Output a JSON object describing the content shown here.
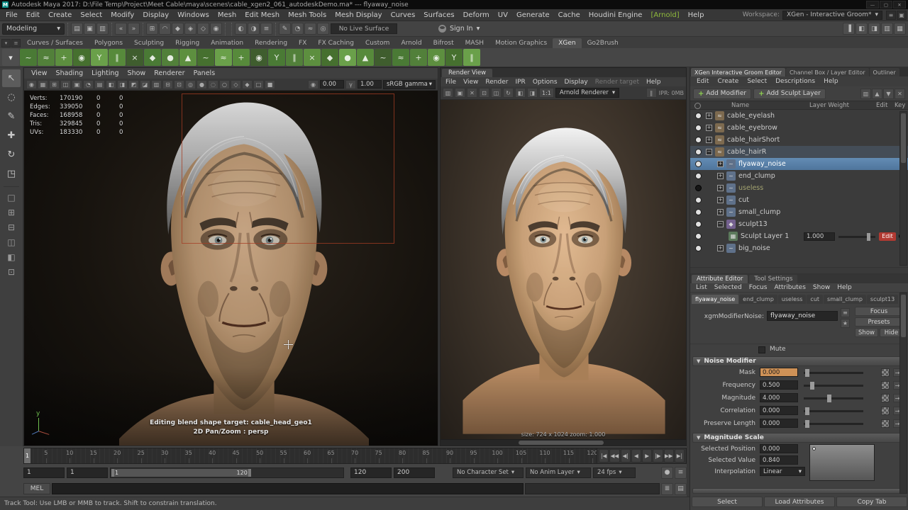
{
  "window": {
    "title": "Autodesk Maya 2017: D:\\File Temp\\Project\\Meet Cable\\maya\\scenes\\cable_xgen2_061_autodeskDemo.ma* --- flyaway_noise",
    "controls": {
      "minimize": "—",
      "maximize": "▢",
      "close": "✕"
    }
  },
  "menu_bar": {
    "items": [
      "File",
      "Edit",
      "Create",
      "Select",
      "Modify",
      "Display",
      "Windows",
      "Mesh",
      "Edit Mesh",
      "Mesh Tools",
      "Mesh Display",
      "Curves",
      "Surfaces",
      "Deform",
      "UV",
      "Generate",
      "Cache",
      "Houdini Engine",
      "[Arnold]",
      "Help"
    ],
    "workspace_label": "Workspace:",
    "workspace_value": "XGen - Interactive Groom*"
  },
  "status_line": {
    "menu_set": "Modeling",
    "live_surface": "No Live Surface",
    "sign_in": "Sign In",
    "icon_groups": [
      [
        "new-scene-icon",
        "open-scene-icon",
        "save-scene-icon"
      ],
      [
        "undo-icon",
        "redo-icon"
      ],
      [
        "snap-to-grid-icon",
        "snap-to-curve-icon",
        "snap-to-point-icon",
        "snap-to-projected-center-icon",
        "snap-to-view-plane-icon",
        "make-live-icon"
      ],
      [
        "render-current-frame-icon",
        "ipr-render-icon",
        "display-render-settings-icon"
      ],
      [
        "paint-effects-icon",
        "toon-shading-icon",
        "xgen-editor-icon",
        "muscle-icon"
      ]
    ],
    "right_icons": [
      "modeling-toolkit-toggle-icon",
      "character-controls-toggle-icon",
      "attribute-editor-toggle-icon",
      "tool-settings-toggle-icon",
      "channel-box-toggle-icon"
    ]
  },
  "shelf": {
    "tabs": [
      "Curves / Surfaces",
      "Polygons",
      "Sculpting",
      "Rigging",
      "Animation",
      "Rendering",
      "FX",
      "FX Caching",
      "Custom",
      "Arnold",
      "Bifrost",
      "MASH",
      "Motion Graphics",
      "XGen",
      "Go2Brush"
    ],
    "active_tab": "XGen"
  },
  "toolbox": {
    "tools": [
      {
        "name": "select-tool",
        "glyph": "↖"
      },
      {
        "name": "lasso-select-tool",
        "glyph": "◌"
      },
      {
        "name": "paint-select-tool",
        "glyph": "✎"
      },
      {
        "name": "move-tool",
        "glyph": "✚"
      },
      {
        "name": "rotate-tool",
        "glyph": "↻"
      },
      {
        "name": "scale-tool",
        "glyph": "◳"
      }
    ],
    "layouts": [
      {
        "name": "layout-single-pane",
        "glyph": "□"
      },
      {
        "name": "layout-four-pane",
        "glyph": "⊞"
      },
      {
        "name": "layout-two-pane-stacked",
        "glyph": "⊟"
      },
      {
        "name": "layout-two-pane-side",
        "glyph": "◫"
      },
      {
        "name": "layout-persp-outliner",
        "glyph": "◧"
      },
      {
        "name": "layout-custom",
        "glyph": "⊡"
      }
    ]
  },
  "viewport": {
    "menus": [
      "View",
      "Shading",
      "Lighting",
      "Show",
      "Renderer",
      "Panels"
    ],
    "toolbar_icons": [
      "select-camera-icon",
      "lock-camera-icon",
      "camera-attributes-icon",
      "bookmark-icon",
      "image-plane-icon",
      "2d-pan-zoom-icon",
      "grease-pencil-icon",
      "grid-icon",
      "film-gate-icon",
      "resolution-gate-icon",
      "gate-mask-icon",
      "field-chart-icon",
      "safe-action-icon",
      "safe-title-icon",
      "wireframe-mode-icon",
      "shaded-mode-icon",
      "textured-mode-icon",
      "use-all-lights-icon",
      "shadows-icon",
      "ambient-occlusion-icon",
      "motion-blur-icon",
      "anti-alias-icon"
    ],
    "stats_rows": [
      [
        "Verts:",
        "170190",
        "0",
        "0"
      ],
      [
        "Edges:",
        "339050",
        "0",
        "0"
      ],
      [
        "Faces:",
        "168958",
        "0",
        "0"
      ],
      [
        "Tris:",
        "329845",
        "0",
        "0"
      ],
      [
        "UVs:",
        "183330",
        "0",
        "0"
      ]
    ],
    "exposure": "0.00",
    "gamma": "1.00",
    "colorspace": "sRGB gamma",
    "overlay_line1": "Editing blend shape target: cable_head_geo1",
    "overlay_line2": "2D Pan/Zoom : persp",
    "axis_label": "y"
  },
  "render_view": {
    "tab": "Render View",
    "menus": [
      "File",
      "View",
      "Render",
      "IPR",
      "Options",
      "Display",
      "Render target",
      "Help"
    ],
    "disabled_menu": "Render target",
    "toolbar_icons": [
      "save-image-icon",
      "open-image-icon",
      "remove-image-icon",
      "render-region-icon",
      "snapshot-icon",
      "ipr-refresh-icon",
      "rgb-channel-icon",
      "alpha-channel-icon",
      "pause-ipr-icon",
      "stop-ipr-icon"
    ],
    "renderer": "Arnold Renderer",
    "ratio": "1:1",
    "ipr_status": "IPR: 0MB",
    "size_status": "size: 724 x 1024 zoom: 1.000"
  },
  "groom_editor": {
    "panel_tabs": [
      "XGen Interactive Groom Editor",
      "Channel Box / Layer Editor",
      "Outliner"
    ],
    "active_panel_tab": "XGen Interactive Groom Editor",
    "menus": [
      "Edit",
      "Create",
      "Select",
      "Descriptions",
      "Help"
    ],
    "add_modifier_label": "Add Modifier",
    "add_sculpt_layer_label": "Add Sculpt Layer",
    "toolbar_icons": [
      "display-toggle-icon",
      "move-up-icon",
      "move-down-icon",
      "delete-icon"
    ],
    "columns": {
      "name": "Name",
      "layer_weight": "Layer Weight",
      "edit": "Edit",
      "key": "Key"
    },
    "tree": [
      {
        "label": "cable_eyelash",
        "depth": 0,
        "kind": "description",
        "expander": "+",
        "vis": true
      },
      {
        "label": "cable_eyebrow",
        "depth": 0,
        "kind": "description",
        "expander": "+",
        "vis": true
      },
      {
        "label": "cable_hairShort",
        "depth": 0,
        "kind": "description",
        "expander": "+",
        "vis": true
      },
      {
        "label": "cable_hairR",
        "depth": 0,
        "kind": "description",
        "expander": "-",
        "vis": true,
        "lead": true
      },
      {
        "label": "flyaway_noise",
        "depth": 1,
        "kind": "modifier",
        "expander": "+",
        "vis": true,
        "selected": true
      },
      {
        "label": "end_clump",
        "depth": 1,
        "kind": "modifier",
        "expander": "+",
        "vis": true
      },
      {
        "label": "useless",
        "depth": 1,
        "kind": "modifier",
        "expander": "+",
        "vis": false,
        "muted": true
      },
      {
        "label": "cut",
        "depth": 1,
        "kind": "modifier",
        "expander": "+",
        "vis": true
      },
      {
        "label": "small_clump",
        "depth": 1,
        "kind": "modifier",
        "expander": "+",
        "vis": true
      },
      {
        "label": "sculpt13",
        "depth": 1,
        "kind": "sculpt",
        "expander": "-",
        "vis": true
      },
      {
        "label": "Sculpt Layer 1",
        "depth": 2,
        "kind": "layer",
        "vis": true,
        "weight": "1.000",
        "edit_label": "Edit"
      },
      {
        "label": "big_noise",
        "depth": 1,
        "kind": "modifier",
        "expander": "+",
        "vis": true
      }
    ]
  },
  "attribute_editor": {
    "panel_tabs": [
      "Attribute Editor",
      "Tool Settings"
    ],
    "active_panel_tab": "Attribute Editor",
    "menus": [
      "List",
      "Selected",
      "Focus",
      "Attributes",
      "Show",
      "Help"
    ],
    "node_tabs": [
      "flyaway_noise",
      "end_clump",
      "useless",
      "cut",
      "small_clump",
      "sculpt13"
    ],
    "active_node_tab": "flyaway_noise",
    "node_type_label": "xgmModifierNoise:",
    "node_name": "flyaway_noise",
    "focus_label": "Focus",
    "presets_label": "Presets",
    "show_label": "Show",
    "hide_label": "Hide",
    "mute_label": "Mute",
    "noise_section": {
      "title": "Noise Modifier",
      "fields": [
        {
          "label": "Mask",
          "value": "0.000",
          "slider": 0.03,
          "connected": true
        },
        {
          "label": "Frequency",
          "value": "0.500",
          "slider": 0.12
        },
        {
          "label": "Magnitude",
          "value": "4.000",
          "slider": 0.42
        },
        {
          "label": "Correlation",
          "value": "0.000",
          "slider": 0.03
        },
        {
          "label": "Preserve Length",
          "value": "0.000",
          "slider": 0.03
        }
      ]
    },
    "magnitude_section": {
      "title": "Magnitude Scale",
      "fields": [
        {
          "label": "Selected Position",
          "value": "0.000"
        },
        {
          "label": "Selected Value",
          "value": "0.840"
        },
        {
          "label": "Interpolation",
          "value": "Linear",
          "type": "dropdown"
        }
      ]
    },
    "footer_buttons": [
      "Select",
      "Load Attributes",
      "Copy Tab"
    ]
  },
  "timeline": {
    "start": 1,
    "end": 120,
    "label_step": 5,
    "current": "1",
    "transport": [
      {
        "name": "go-to-start-button",
        "glyph": "|◀"
      },
      {
        "name": "step-back-one-key-button",
        "glyph": "◀◀"
      },
      {
        "name": "step-back-one-frame-button",
        "glyph": "◀|"
      },
      {
        "name": "play-backwards-button",
        "glyph": "◀"
      },
      {
        "name": "play-forwards-button",
        "glyph": "▶"
      },
      {
        "name": "step-forward-one-frame-button",
        "glyph": "|▶"
      },
      {
        "name": "step-forward-one-key-button",
        "glyph": "▶▶"
      },
      {
        "name": "go-to-end-button",
        "glyph": "▶|"
      }
    ]
  },
  "range_bar": {
    "anim_start": "1",
    "play_start": "1",
    "bar_left": "1",
    "bar_right": "120",
    "play_end": "120",
    "anim_end": "200",
    "char_set": "No Character Set",
    "anim_layer": "No Anim Layer",
    "fps": "24 fps",
    "icons": [
      "auto-keyframe-icon",
      "animation-preferences-icon"
    ]
  },
  "command_line": {
    "label": "MEL",
    "icons": [
      "command-history-icon",
      "script-editor-icon"
    ]
  },
  "help_line": {
    "text": "Track Tool: Use LMB or MMB to track. Shift to constrain translation."
  },
  "colors": {
    "selection_blue": "#5b84ad",
    "xgen_green": "#77b341",
    "edit_red": "#b23a32",
    "mask_orange": "#cf9257"
  }
}
